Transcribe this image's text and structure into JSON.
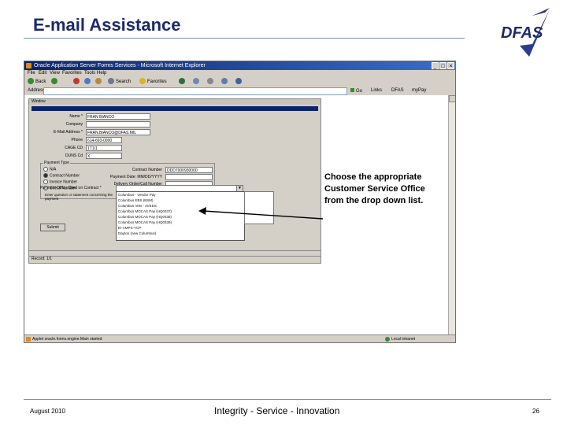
{
  "slide": {
    "title": "E-mail Assistance",
    "logo_text": "DFAS",
    "callout": "Choose the appropriate Customer Service Office from the drop down list.",
    "footer_date": "August 2010",
    "footer_tagline": "Integrity - Service - Innovation",
    "page_number": "26"
  },
  "browser": {
    "title": "Oracle Application Server Forms Services - Microsoft Internet Explorer",
    "menu": [
      "File",
      "Edit",
      "View",
      "Favorites",
      "Tools",
      "Help"
    ],
    "toolbar": {
      "back": "Back",
      "search": "Search",
      "favorites": "Favorites"
    },
    "address_label": "Address",
    "go_label": "Go",
    "links_label": "Links",
    "links": [
      "DFAS",
      "myPay"
    ],
    "status_left": "Applet oracle.forms.engine.Main started",
    "status_right": "Local intranet"
  },
  "form": {
    "window_label": "Window",
    "name_label": "Name *",
    "name_value": "FRAN BIANCO",
    "company_label": "Company",
    "company_value": "",
    "email_label": "E-Mail Address *",
    "email_value": "FRAN.BIANCO@DFAS.MIL",
    "phone_label": "Phone",
    "phone_value": "614-693-0000",
    "cage_label": "CAGE CD",
    "cage_value": "1T1I1",
    "duns_label": "DUNS Cd",
    "duns_value": "X",
    "payment_type_label": "Payment Type",
    "payment_types": [
      "N/A",
      "Contract Number",
      "Invoice Number",
      "Check Number"
    ],
    "contract_label": "Contract Number",
    "contract_value": "DDD7000930000",
    "payment_date_label": "Payment Date: MM/DD/YYYY",
    "payment_date_value": "",
    "delivery_label": "Delivery Order/Call Number",
    "delivery_value": "",
    "invoice_label": "Invoice Number",
    "invoice_value": "231522",
    "poc_label": "Payment Office Cited on Contract *",
    "questions_label": "Enter question or statement concerning the payment",
    "dropdown_options": [
      "Columbus - Vendor Pay",
      "Columbus EBS (BSM)",
      "Columbus Vets - AVEDS",
      "Columbus MOCAS Pay (HQ0337)",
      "Columbus MOCAS Pay (HQ0338)",
      "Columbus MOCAS Pay (HQ0339)",
      "EI-AMPS-YCP",
      "Dayton (new Columbus)"
    ],
    "submit_label": "Submit",
    "record_label": "Record: 1/1"
  }
}
